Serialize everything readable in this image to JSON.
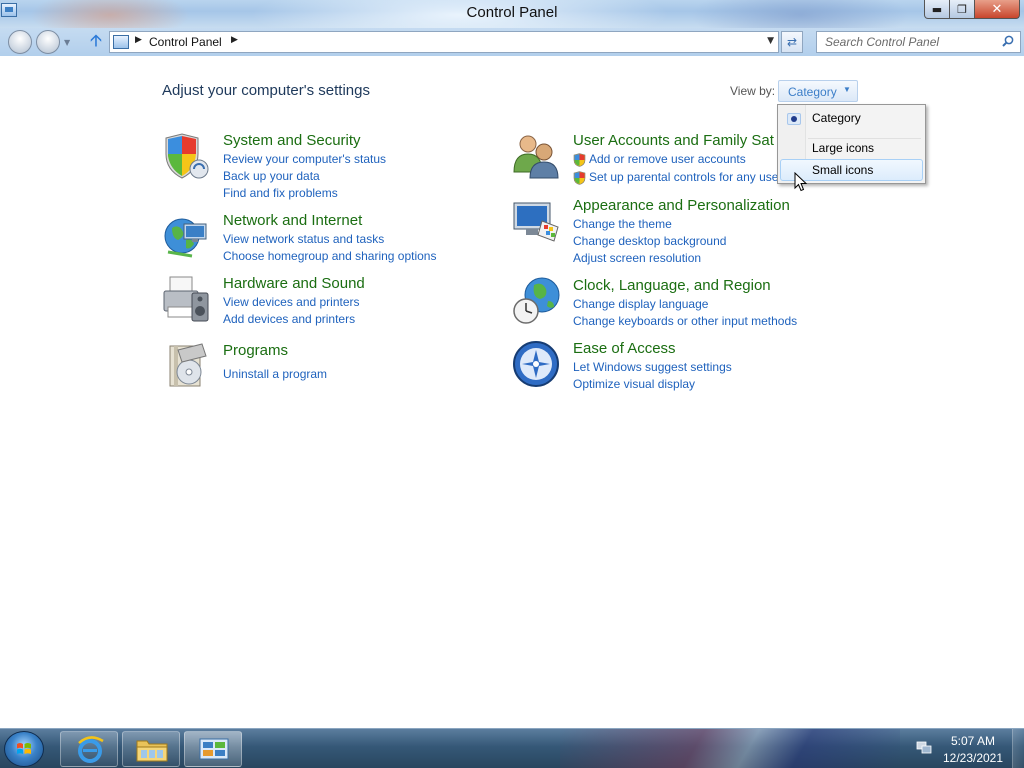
{
  "window": {
    "title": "Control Panel"
  },
  "navigation": {
    "breadcrumb": [
      "Control Panel"
    ],
    "search_placeholder": "Search Control Panel"
  },
  "page": {
    "title": "Adjust your computer's settings",
    "view_by_label": "View by:",
    "view_by_value": "Category"
  },
  "categories": [
    {
      "title": "System and Security",
      "icon": "shield-icon",
      "links": [
        "Review your computer's status",
        "Back up your data",
        "Find and fix problems"
      ]
    },
    {
      "title": "Network and Internet",
      "icon": "network-globe-icon",
      "links": [
        "View network status and tasks",
        "Choose homegroup and sharing options"
      ]
    },
    {
      "title": "Hardware and Sound",
      "icon": "printer-speaker-icon",
      "links": [
        "View devices and printers",
        "Add devices and printers"
      ]
    },
    {
      "title": "Programs",
      "icon": "programs-disc-icon",
      "links": [
        "Uninstall a program"
      ]
    },
    {
      "title": "User Accounts and Family Sat",
      "icon": "users-icon",
      "links": [
        "Add or remove user accounts",
        "Set up parental controls for any use"
      ]
    },
    {
      "title": "Appearance and Personalization",
      "icon": "monitor-paint-icon",
      "links": [
        "Change the theme",
        "Change desktop background",
        "Adjust screen resolution"
      ]
    },
    {
      "title": "Clock, Language, and Region",
      "icon": "clock-globe-icon",
      "links": [
        "Change display language",
        "Change keyboards or other input methods"
      ]
    },
    {
      "title": "Ease of Access",
      "icon": "ease-of-access-icon",
      "links": [
        "Let Windows suggest settings",
        "Optimize visual display"
      ]
    }
  ],
  "view_menu": {
    "items": [
      {
        "label": "Category",
        "selected": true
      },
      {
        "label": "Large icons",
        "selected": false
      },
      {
        "label": "Small icons",
        "selected": false,
        "hovered": true
      }
    ]
  },
  "taskbar": {
    "apps": [
      "internet-explorer-icon",
      "file-explorer-icon",
      "control-panel-icon"
    ],
    "time": "5:07 AM",
    "date": "12/23/2021"
  },
  "colors": {
    "category_title": "#1b6e12",
    "link": "#1f62bd",
    "page_title": "#1e395b"
  }
}
